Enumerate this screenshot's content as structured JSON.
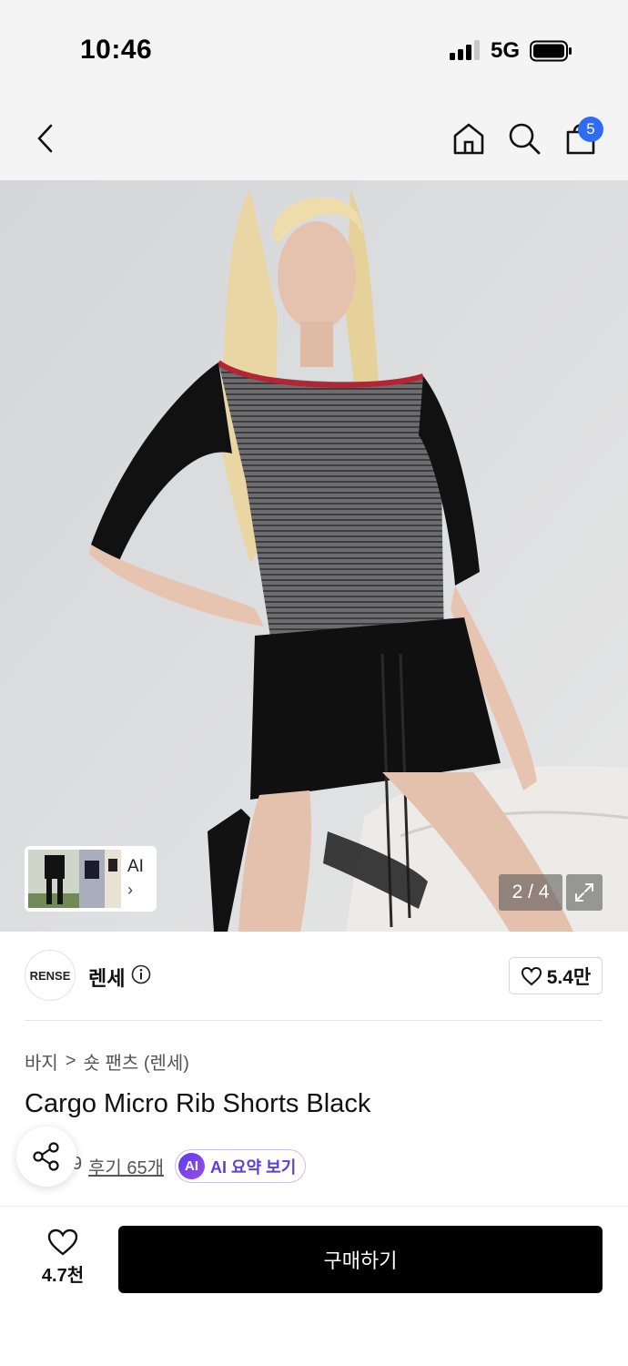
{
  "status_bar": {
    "time": "10:46",
    "network": "5G"
  },
  "nav": {
    "cart_count": "5"
  },
  "gallery": {
    "counter": "2 / 4",
    "thumb_label": "AI",
    "thumb_chevron": "›"
  },
  "brand": {
    "logo_text": "RENSE",
    "name": "렌세",
    "likes": "5.4만"
  },
  "product": {
    "breadcrumb": [
      "바지",
      "숏 팬츠 (렌세)"
    ],
    "breadcrumb_sep": ">",
    "title": "Cargo Micro Rib Shorts Black",
    "rating_partial": "9",
    "reviews": "후기 65개",
    "ai_badge": "AI",
    "ai_summary": "AI 요약 보기"
  },
  "bottom": {
    "wish_count": "4.7천",
    "buy_label": "구매하기"
  },
  "colors": {
    "accent_badge": "#2f6cf5",
    "ai_purple": "#5b3fd6",
    "button": "#000000"
  },
  "icons": [
    "back-icon",
    "home-icon",
    "search-icon",
    "cart-icon",
    "expand-icon",
    "info-icon",
    "heart-icon",
    "share-icon"
  ]
}
